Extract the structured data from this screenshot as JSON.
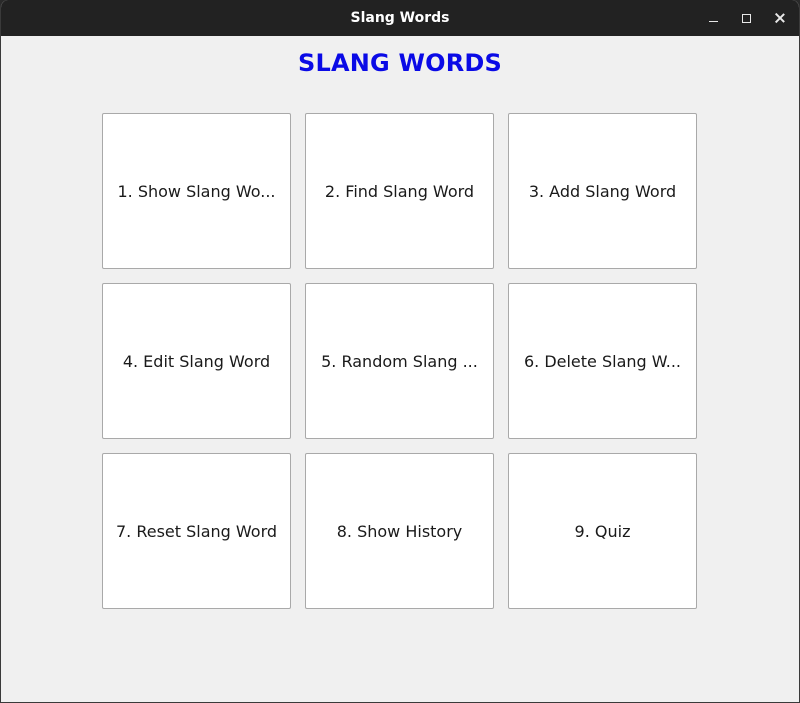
{
  "window": {
    "title": "Slang Words",
    "controls": {
      "minimize_icon": "minimize-icon",
      "maximize_icon": "maximize-icon",
      "close_icon": "close-icon"
    }
  },
  "main": {
    "heading": "SLANG WORDS",
    "heading_color": "#0a0ae6",
    "menu_buttons": [
      {
        "label": "1. Show Slang Wo..."
      },
      {
        "label": "2. Find Slang Word"
      },
      {
        "label": "3. Add Slang Word"
      },
      {
        "label": "4. Edit Slang Word"
      },
      {
        "label": "5. Random Slang ..."
      },
      {
        "label": "6. Delete Slang W..."
      },
      {
        "label": "7. Reset Slang Word"
      },
      {
        "label": "8. Show History"
      },
      {
        "label": "9. Quiz"
      }
    ]
  }
}
